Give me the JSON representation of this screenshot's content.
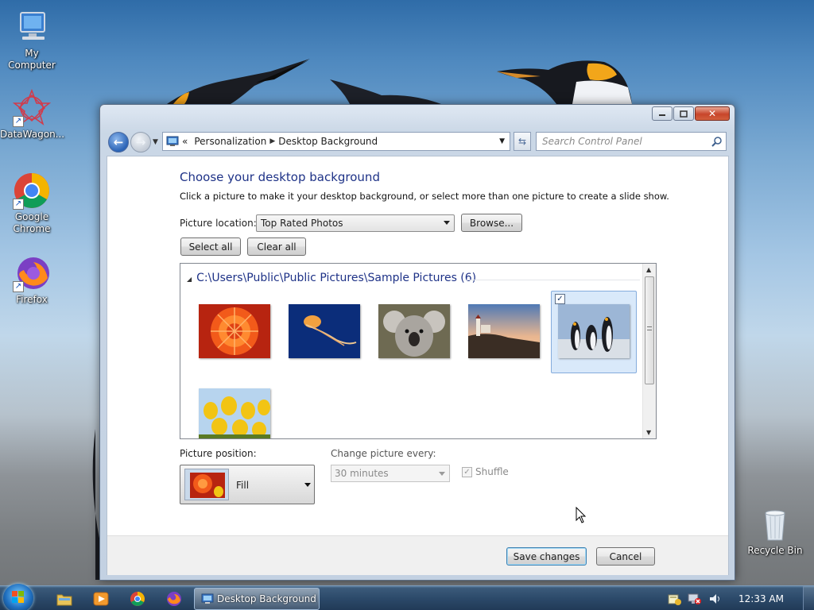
{
  "desktop": {
    "icons": [
      {
        "label": "My Computer",
        "icon": "computer-icon"
      },
      {
        "label": "DataWagon...",
        "icon": "datawagon-icon"
      },
      {
        "label": "Google Chrome",
        "icon": "chrome-icon"
      },
      {
        "label": "Firefox",
        "icon": "firefox-icon"
      },
      {
        "label": "Recycle Bin",
        "icon": "recycle-bin-icon"
      }
    ]
  },
  "window": {
    "caption_buttons": {
      "minimize": "minimize-icon",
      "maximize": "maximize-icon",
      "close": "✕"
    },
    "breadcrumb": {
      "prefix": "«",
      "items": [
        "Personalization",
        "Desktop Background"
      ]
    },
    "search": {
      "placeholder": "Search Control Panel"
    },
    "title": "Choose your desktop background",
    "subtitle": "Click a picture to make it your desktop background, or select more than one picture to create a slide show.",
    "picture_location": {
      "label": "Picture location:",
      "value": "Top Rated Photos"
    },
    "browse_label": "Browse...",
    "select_all_label": "Select all",
    "clear_all_label": "Clear all",
    "gallery": {
      "folder": "C:\\Users\\Public\\Public Pictures\\Sample Pictures (6)",
      "pictures": [
        {
          "name": "chrysanthemum",
          "selected": false
        },
        {
          "name": "jellyfish",
          "selected": false
        },
        {
          "name": "koala",
          "selected": false
        },
        {
          "name": "lighthouse",
          "selected": false
        },
        {
          "name": "penguins",
          "selected": true
        },
        {
          "name": "tulips",
          "selected": false
        }
      ]
    },
    "picture_position": {
      "label": "Picture position:",
      "value": "Fill"
    },
    "change_interval": {
      "label": "Change picture every:",
      "value": "30 minutes",
      "enabled": false
    },
    "shuffle": {
      "label": "Shuffle",
      "checked": true,
      "enabled": false
    },
    "save_label": "Save changes",
    "cancel_label": "Cancel"
  },
  "taskbar": {
    "pinned": [
      "explorer-icon",
      "media-player-icon",
      "chrome-icon",
      "firefox-icon"
    ],
    "active_window": "Desktop Background",
    "clock": "12:33 AM",
    "tray_icons": [
      "action-center-icon",
      "network-error-icon",
      "volume-icon"
    ]
  },
  "colors": {
    "accent": "#1e3287",
    "selection": "#d9e9fa",
    "taskbar": "#2c4a6a"
  }
}
